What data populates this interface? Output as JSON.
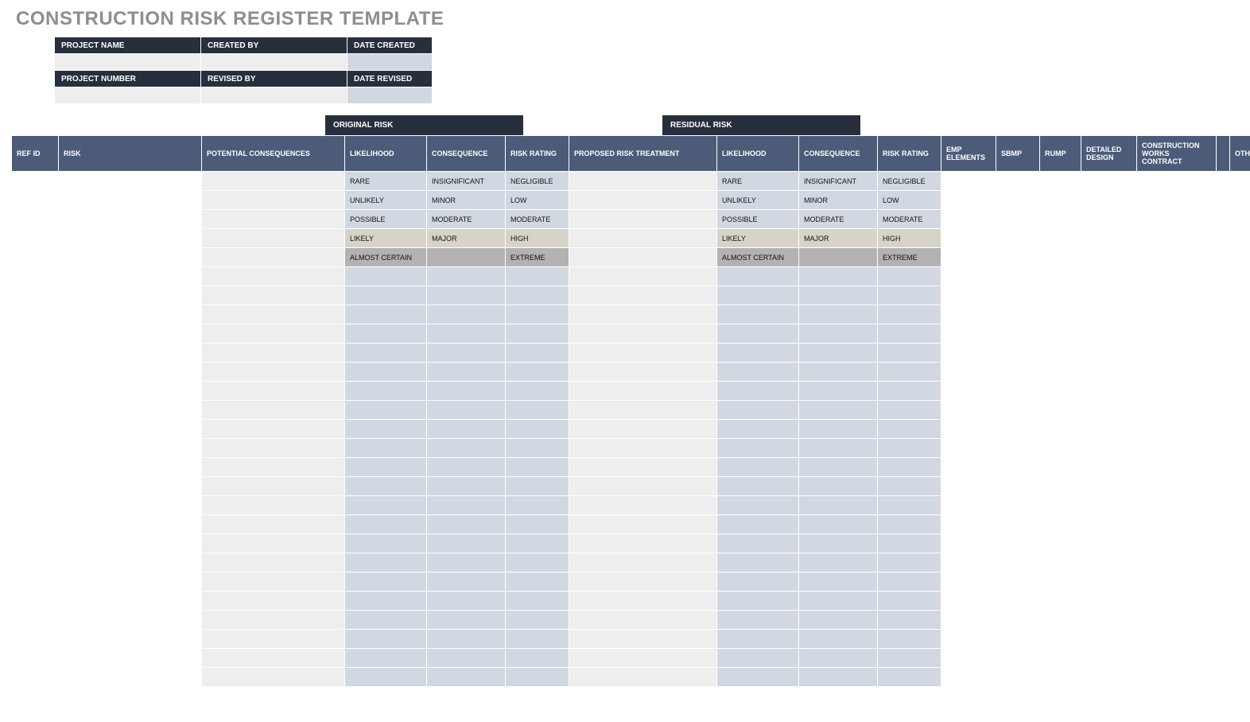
{
  "title": "CONSTRUCTION RISK REGISTER TEMPLATE",
  "meta": {
    "row1": {
      "projectName": "PROJECT NAME",
      "createdBy": "CREATED BY",
      "dateCreated": "DATE CREATED"
    },
    "row2": {
      "projectNumber": "PROJECT NUMBER",
      "revisedBy": "REVISED BY",
      "dateRevised": "DATE REVISED"
    },
    "vals": {
      "projectName": "",
      "createdBy": "",
      "dateCreated": "",
      "projectNumber": "",
      "revisedBy": "",
      "dateRevised": ""
    }
  },
  "sections": {
    "original": "ORIGINAL RISK",
    "residual": "RESIDUAL RISK"
  },
  "columns": {
    "refId": "REF ID",
    "risk": "RISK",
    "potCons": "POTENTIAL CONSEQUENCES",
    "likelihood": "LIKELIHOOD",
    "consequence": "CONSEQUENCE",
    "riskRating": "RISK RATING",
    "treatment": "PROPOSED RISK TREATMENT",
    "emp": "EMP ELEMENTS",
    "sbmp": "SBMP",
    "rump": "RUMP",
    "dd": "DETAILED DESIGN",
    "cwc": "CONSTRUCTION WORKS CONTRACT",
    "other": "OTHER"
  },
  "likelihoodScale": [
    "RARE",
    "UNLIKELY",
    "POSSIBLE",
    "LIKELY",
    "ALMOST CERTAIN"
  ],
  "consequenceScale": [
    "INSIGNIFICANT",
    "MINOR",
    "MODERATE",
    "MAJOR",
    ""
  ],
  "ratingScale": [
    "NEGLIGIBLE",
    "LOW",
    "MODERATE",
    "HIGH",
    "EXTREME"
  ],
  "blankRowCount": 22
}
